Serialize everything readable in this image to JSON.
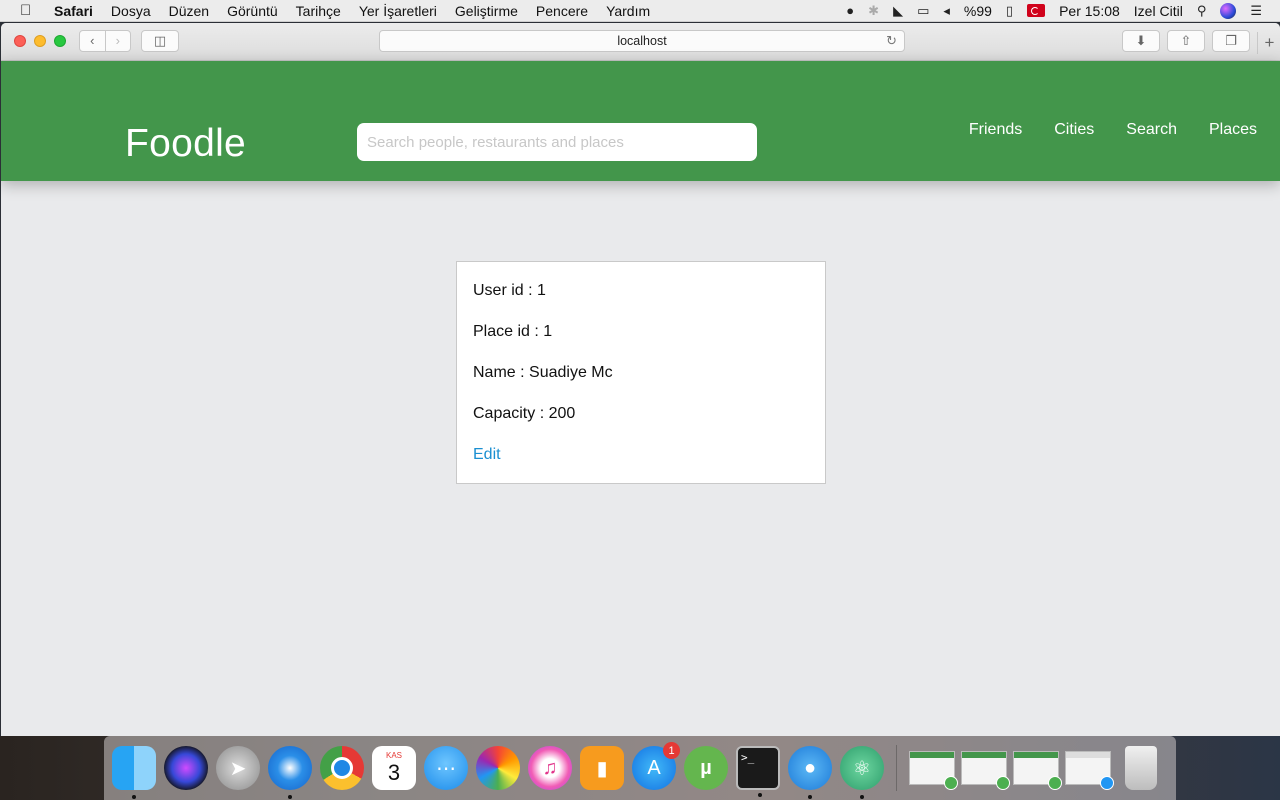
{
  "menubar": {
    "app_name": "Safari",
    "menus": [
      "Dosya",
      "Düzen",
      "Görüntü",
      "Tarihçe",
      "Yer İşaretleri",
      "Geliştirme",
      "Pencere",
      "Yardım"
    ],
    "battery": "%99",
    "clock": "Per 15:08",
    "user": "Izel Citil"
  },
  "browser": {
    "url": "localhost"
  },
  "header": {
    "brand": "Foodle",
    "search_placeholder": "Search people, restaurants and places",
    "nav": [
      "Friends",
      "Cities",
      "Search",
      "Places"
    ],
    "color": "#43964b"
  },
  "place_card": {
    "user_id": "User id : 1",
    "place_id": "Place id : 1",
    "name": "Name : Suadiye Mc",
    "capacity": "Capacity : 200",
    "edit_label": "Edit",
    "link_color": "#1a8fd1"
  },
  "dock": {
    "calendar_month": "KAS",
    "calendar_day": "3",
    "appstore_badge": "1"
  }
}
